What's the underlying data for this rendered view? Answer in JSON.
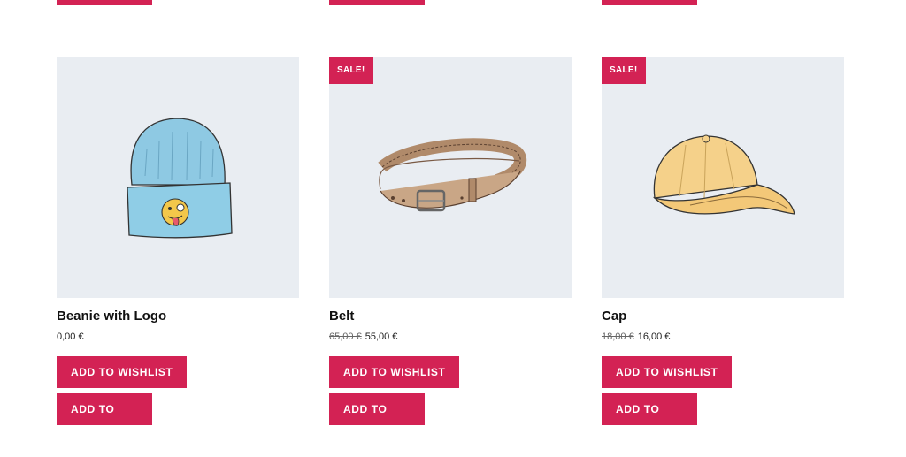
{
  "colors": {
    "accent": "#d32254",
    "thumb_bg": "#e9edf2"
  },
  "products": [
    {
      "title": "Beanie with Logo",
      "price_old": "",
      "price": "0,00 €",
      "badge": "",
      "wishlist_label": "ADD TO WISHLIST",
      "cart_label": "ADD TO CART"
    },
    {
      "title": "Belt",
      "price_old": "65,00 €",
      "price": "55,00 €",
      "badge": "SALE!",
      "wishlist_label": "ADD TO WISHLIST",
      "cart_label": "ADD TO CART"
    },
    {
      "title": "Cap",
      "price_old": "18,00 €",
      "price": "16,00 €",
      "badge": "SALE!",
      "wishlist_label": "ADD TO WISHLIST",
      "cart_label": "ADD TO CART"
    }
  ]
}
